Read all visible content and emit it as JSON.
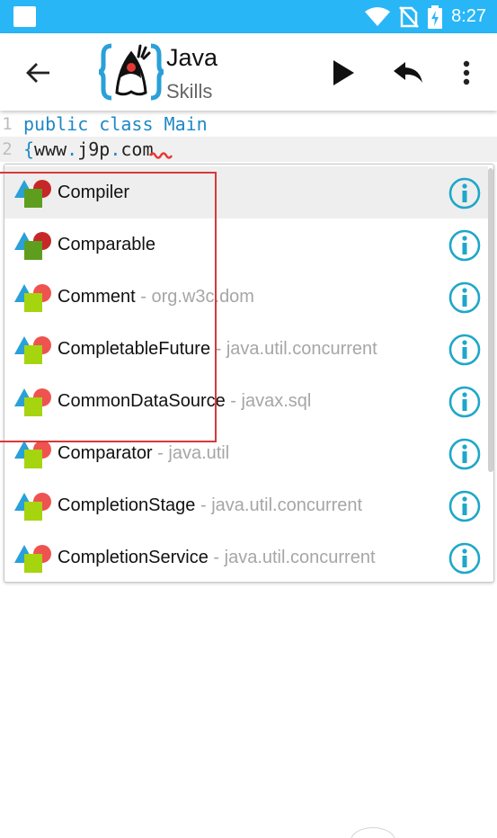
{
  "status_bar": {
    "time": "8:27",
    "icons": [
      "notification-icon",
      "wifi-icon",
      "no-sim-icon",
      "battery-charging-icon"
    ]
  },
  "app_bar": {
    "title": "Java",
    "subtitle": "Skills",
    "icons": [
      "back-arrow-icon",
      "java-duke-logo-icon",
      "play-icon",
      "undo-icon",
      "more-vert-icon"
    ]
  },
  "editor": {
    "lines": [
      {
        "number": "1",
        "tokens": [
          {
            "text": "public class Main",
            "kind": "keyword"
          }
        ]
      },
      {
        "number": "2",
        "tokens": [
          {
            "text": "{",
            "kind": "keyword"
          },
          {
            "text": "www",
            "kind": "plain"
          },
          {
            "text": ".",
            "kind": "keyword"
          },
          {
            "text": "j9p",
            "kind": "plain"
          },
          {
            "text": ".",
            "kind": "keyword"
          },
          {
            "text": "com",
            "kind": "plain"
          }
        ]
      }
    ],
    "error_color": "#e53935"
  },
  "autocomplete": {
    "items": [
      {
        "name": "Compiler",
        "package": "",
        "icon": "class-icon"
      },
      {
        "name": "Comparable",
        "package": "",
        "icon": "class-icon"
      },
      {
        "name": "Comment",
        "package": " - org.w3c.dom",
        "icon": "interface-icon"
      },
      {
        "name": "CompletableFuture",
        "package": " - java.util.concurrent",
        "icon": "interface-icon"
      },
      {
        "name": "CommonDataSource",
        "package": " - javax.sql",
        "icon": "interface-icon"
      },
      {
        "name": "Comparator",
        "package": " - java.util",
        "icon": "interface-icon"
      },
      {
        "name": "CompletionStage",
        "package": " - java.util.concurrent",
        "icon": "interface-icon"
      },
      {
        "name": "CompletionService",
        "package": " - java.util.concurrent",
        "icon": "interface-icon"
      }
    ],
    "selected_index": 0,
    "info_icon": "info-icon"
  },
  "colors": {
    "status_bar": "#29b6f6",
    "keyword": "#1e88c7",
    "info_icon": "#1ea7c9",
    "highlight_box": "#d9383a",
    "icon_blue": "#29a0d8",
    "icon_green_dark": "#5e9e1e",
    "icon_green_light": "#a6d40f",
    "icon_red_dark": "#c62828",
    "icon_red_light": "#ef5350"
  }
}
